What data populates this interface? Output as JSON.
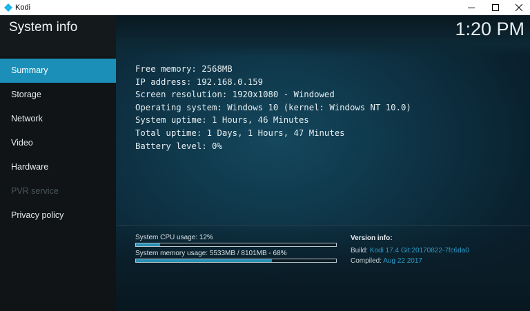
{
  "window": {
    "title": "Kodi",
    "controls": [
      "minimize",
      "maximize",
      "close"
    ]
  },
  "header": {
    "title": "System info",
    "clock": "1:20 PM"
  },
  "sidebar": {
    "items": [
      {
        "label": "Summary",
        "state": "active"
      },
      {
        "label": "Storage",
        "state": "normal"
      },
      {
        "label": "Network",
        "state": "normal"
      },
      {
        "label": "Video",
        "state": "normal"
      },
      {
        "label": "Hardware",
        "state": "normal"
      },
      {
        "label": "PVR service",
        "state": "disabled"
      },
      {
        "label": "Privacy policy",
        "state": "normal"
      }
    ]
  },
  "summary": {
    "lines": [
      "Free memory: 2568MB",
      "IP address: 192.168.0.159",
      "Screen resolution: 1920x1080 - Windowed",
      "Operating system: Windows 10 (kernel: Windows NT 10.0)",
      "System uptime: 1 Hours, 46 Minutes",
      "Total uptime: 1 Days, 1 Hours, 47 Minutes",
      "Battery level: 0%"
    ]
  },
  "footer": {
    "cpu": {
      "label": "System CPU usage: 12%",
      "percent": 12
    },
    "memory": {
      "label": "System memory usage: 5533MB / 8101MB - 68%",
      "percent": 68
    },
    "version": {
      "title": "Version info:",
      "build_label": "Build:",
      "build_value": "Kodi 17.4 Git:20170822-7fc6da0",
      "compiled_label": "Compiled:",
      "compiled_value": "Aug 22 2017"
    }
  },
  "colors": {
    "accent": "#1b8fb8",
    "value_text": "#2b9bc9",
    "sidebar_bg": "#101416"
  }
}
